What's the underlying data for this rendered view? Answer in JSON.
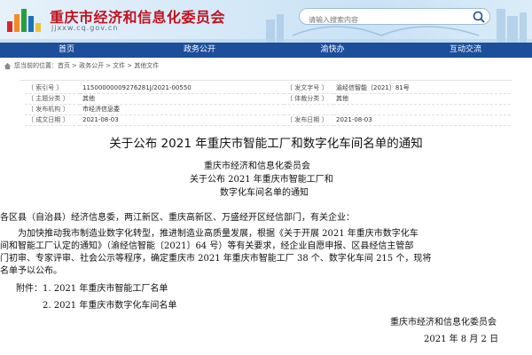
{
  "header": {
    "site_title": "重庆市经济和信息化委员会",
    "site_url": "jjxxw.cq.gov.cn",
    "search_placeholder": "请输入搜索内容"
  },
  "nav": {
    "items": [
      "首页",
      "政务公开",
      "渝快办",
      "互动交流"
    ]
  },
  "breadcrumb": {
    "items": [
      "您当前的位置：首页",
      "> 政务公开",
      "> 文件",
      "> 其他文件"
    ]
  },
  "meta": {
    "rows": [
      {
        "l1": "〔 索引号 〕",
        "v1": "11500000009276281J/2021-00550",
        "l2": "〔 发文字号 〕",
        "v2": "渝经信智能〔2021〕81号"
      },
      {
        "l1": "〔 主题分类 〕",
        "v1": "其他",
        "l2": "〔 体裁分类 〕",
        "v2": "其他"
      },
      {
        "l1": "〔 发布机构 〕",
        "v1": "市经济信息委",
        "l2": "",
        "v2": ""
      },
      {
        "l1": "〔 成文日期 〕",
        "v1": "2021-08-03",
        "l2": "〔 发布日期 〕",
        "v2": "2021-08-03"
      }
    ]
  },
  "document": {
    "title": "关于公布 2021 年重庆市智能工厂和数字化车间名单的通知",
    "sender_lines": [
      "重庆市经济和信息化委员会",
      "关于公布 2021 年重庆市智能工厂和",
      "数字化车间名单的通知"
    ],
    "salutation": "各区县（自治县）经济信息委，两江新区、重庆高新区、万盛经开区经信部门，有关企业：",
    "paragraph_lines": [
      "为加快推动我市制造业数字化转型，推进制造业高质量发展，根据《关于开展 2021 年重庆市数字化车",
      "间和智能工厂认定的通知》（渝经信智能〔2021〕64 号）等有关要求，经企业自愿申报、区县经信主管部",
      "门初审、专家评审、社会公示等程序，确定重庆市 2021 年重庆市智能工厂 38 个、数字化车间 215 个，现将",
      "名单予以公布。"
    ],
    "attachments": [
      "附件：1. 2021 年重庆市智能工厂名单",
      "2. 2021 年重庆市数字化车间名单"
    ],
    "signature_org": "重庆市经济和信息化委员会",
    "signature_date": "2021 年 8 月 2 日"
  },
  "colors": {
    "title_red": "#c1121f",
    "nav_blue": "#1c4e9c"
  }
}
